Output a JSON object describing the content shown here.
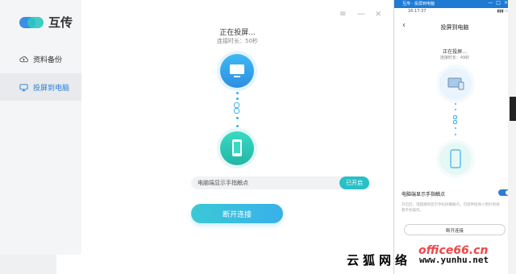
{
  "app": {
    "logo_text": "互传",
    "nav": [
      {
        "label": "资料备份",
        "icon": "cloud-icon"
      },
      {
        "label": "投屏到电脑",
        "icon": "monitor-icon",
        "active": true
      }
    ],
    "window_controls": [
      "≡",
      "—",
      "×"
    ],
    "status_title": "正在投屏...",
    "status_time": "连接时长：50秒",
    "toggle_label": "电脑端显示手指触点",
    "toggle_state": "已开启",
    "disconnect_label": "断开连接",
    "colors": {
      "accent": "#3ab0ea",
      "teal": "#29c0c7",
      "blue": "#2a7cd6"
    }
  },
  "phone": {
    "window_title": "互传 - 投屏到电脑",
    "window_controls": [
      "—",
      "□",
      "×"
    ],
    "time": "16:17:37",
    "back_glyph": "‹",
    "header": "投屏到电脑",
    "status": "正在投屏...",
    "status_time": "连接时长：49秒",
    "setting_label": "电脑端显示手指触点",
    "setting_desc": "开启后，电脑端将显示手机屏幕触点，可提供给他人更好地观看手机操作。",
    "disconnect_label": "断开连接"
  },
  "watermark": {
    "text": "云狐网络",
    "office": "office66.cn",
    "url": "www.yunhu.net"
  }
}
